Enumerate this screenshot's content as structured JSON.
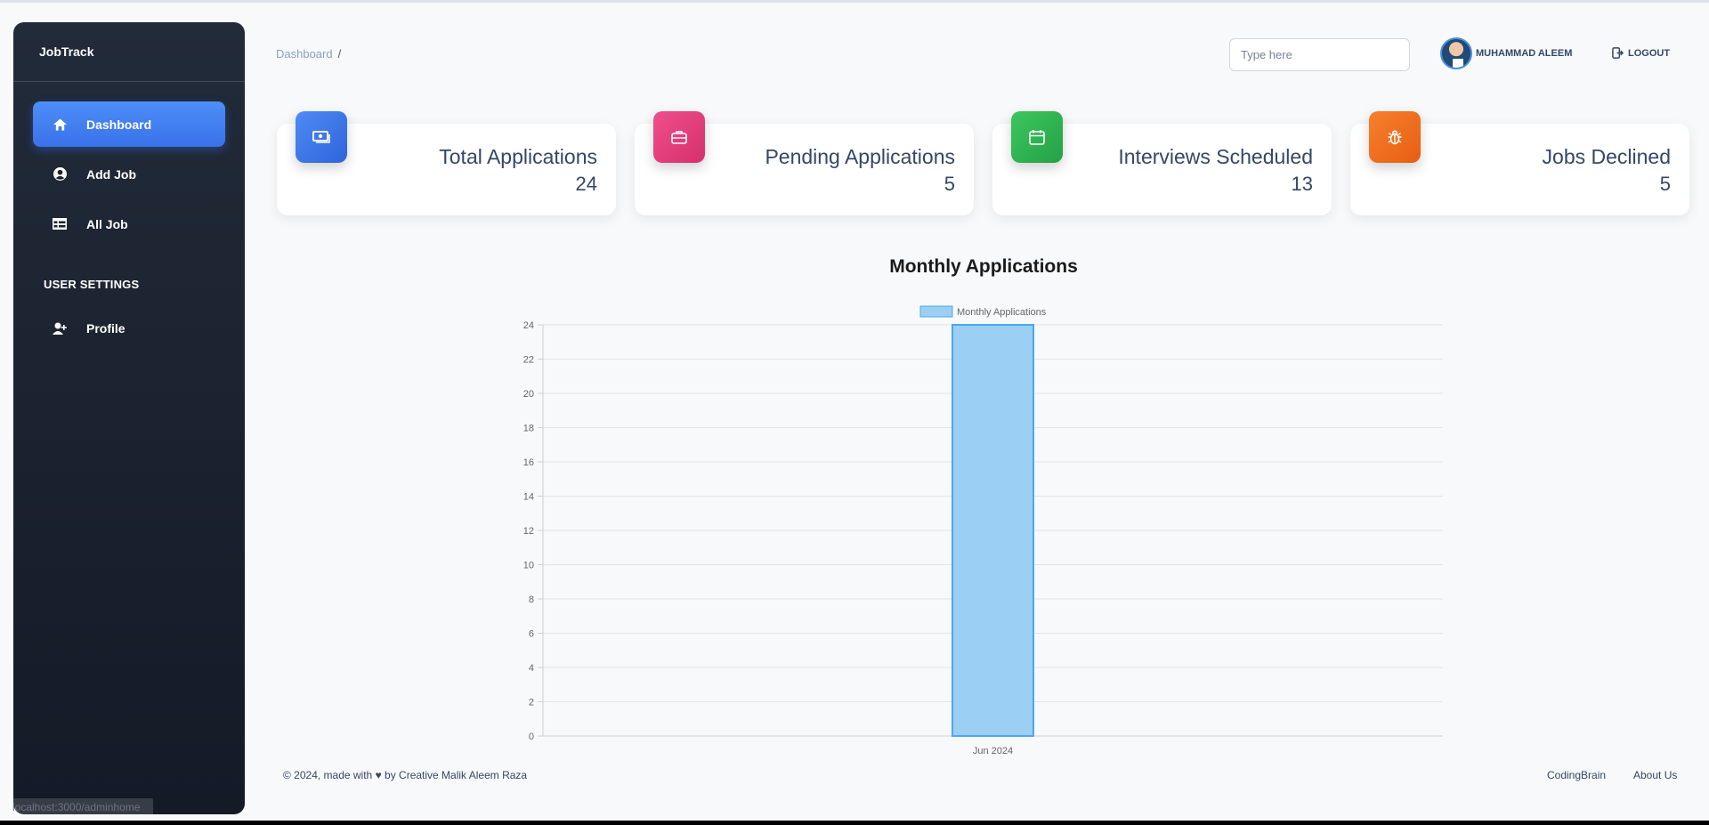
{
  "app": {
    "brand": "JobTrack"
  },
  "sidebar": {
    "items": [
      {
        "label": "Dashboard",
        "icon": "home-icon",
        "active": true
      },
      {
        "label": "Add Job",
        "icon": "user-circle-icon",
        "active": false
      },
      {
        "label": "All Job",
        "icon": "table-icon",
        "active": false
      }
    ],
    "section_title": "USER SETTINGS",
    "settings_items": [
      {
        "label": "Profile",
        "icon": "user-plus-icon"
      }
    ]
  },
  "header": {
    "breadcrumb": "Dashboard",
    "breadcrumb_sep": "/",
    "search_placeholder": "Type here",
    "user_name": "MUHAMMAD ALEEM",
    "logout_label": "LOGOUT"
  },
  "cards": [
    {
      "title": "Total Applications",
      "value": "24",
      "icon": "money-icon",
      "color": "#3a73e8"
    },
    {
      "title": "Pending Applications",
      "value": "5",
      "icon": "briefcase-icon",
      "color": "#e2407b"
    },
    {
      "title": "Interviews Scheduled",
      "value": "13",
      "icon": "calendar-icon",
      "color": "#2fb552"
    },
    {
      "title": "Jobs Declined",
      "value": "5",
      "icon": "bug-icon",
      "color": "#f06d1f"
    }
  ],
  "chart_data": {
    "type": "bar",
    "title": "Monthly Applications",
    "categories": [
      "Jun 2024"
    ],
    "series": [
      {
        "name": "Monthly Applications",
        "values": [
          24
        ]
      }
    ],
    "ylim": [
      0,
      24
    ],
    "y_ticks": [
      0,
      2,
      4,
      6,
      8,
      10,
      12,
      14,
      16,
      18,
      20,
      22,
      24
    ],
    "grid": true,
    "legend": "top",
    "bar_color": "#9bcff3",
    "bar_border_color": "#4ba8ec"
  },
  "footer": {
    "copyright": "© 2024, made with ♥ by Creative Malik Aleem Raza",
    "links": [
      "CodingBrain",
      "About Us"
    ]
  },
  "status": {
    "url": "localhost:3000/adminhome"
  }
}
